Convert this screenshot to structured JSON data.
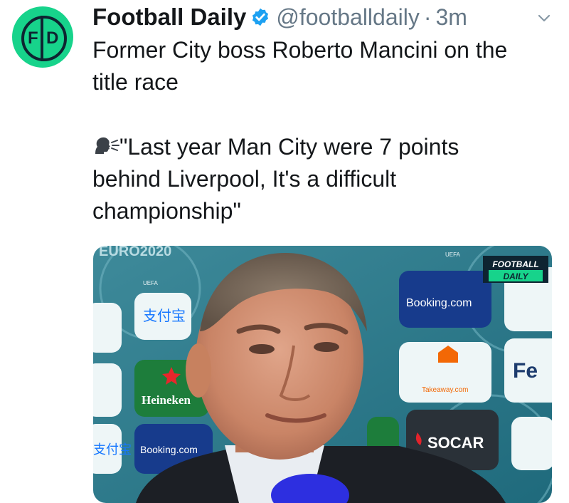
{
  "tweet": {
    "author_name": "Football Daily",
    "handle": "@footballdaily",
    "separator": "·",
    "time": "3m",
    "avatar_letters": {
      "left": "F",
      "right": "D"
    },
    "text_lines": [
      "Former City boss Roberto Mancini on the",
      "title race",
      "\"Last year Man City were 7 points",
      "behind Liverpool, It's a difficult",
      "championship\""
    ],
    "icons": [
      "verified-badge-icon",
      "chevron-down-icon",
      "speaking-head-icon"
    ],
    "colors": {
      "avatar_bg": "#17d38b",
      "verified": "#1da1f2",
      "muted": "#657786"
    }
  },
  "media": {
    "watermark_line1": "FOOTBALL",
    "watermark_line2": "DAILY",
    "board": {
      "euro": "EURO2020",
      "uefa": "UEFA",
      "booking": "Booking.com",
      "heineken": "Heineken",
      "takeaway": "Takeaway.com",
      "socar": "SOCAR",
      "alipay_cn": "支付宝",
      "fe": "Fe",
      "ken": "ken"
    }
  }
}
